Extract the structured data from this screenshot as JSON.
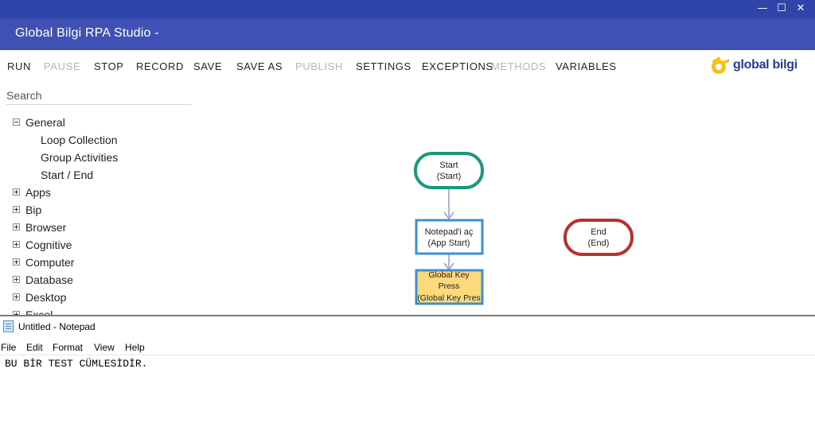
{
  "window": {
    "title": "Global Bilgi RPA Studio -",
    "controls": {
      "minimize": "—",
      "maximize": "☐",
      "close": "✕"
    }
  },
  "toolbar": {
    "items": [
      {
        "label": "RUN",
        "enabled": true
      },
      {
        "label": "PAUSE",
        "enabled": false
      },
      {
        "label": "STOP",
        "enabled": true
      },
      {
        "label": "RECORD",
        "enabled": true
      },
      {
        "label": "SAVE",
        "enabled": true
      },
      {
        "label": "SAVE AS",
        "enabled": true
      },
      {
        "label": "PUBLISH",
        "enabled": false
      },
      {
        "label": "SETTINGS",
        "enabled": true
      },
      {
        "label": "EXCEPTIONS",
        "enabled": true
      },
      {
        "label": "METHODS",
        "enabled": false
      },
      {
        "label": "VARIABLES",
        "enabled": true
      }
    ],
    "logo_text": "global bilgi"
  },
  "search": {
    "placeholder": "Search",
    "value": ""
  },
  "tree": {
    "items": [
      {
        "label": "General",
        "expanded": true
      },
      {
        "label": "Loop Collection",
        "child": true
      },
      {
        "label": "Group Activities",
        "child": true
      },
      {
        "label": "Start / End",
        "child": true
      },
      {
        "label": "Apps",
        "expanded": false
      },
      {
        "label": "Bip",
        "expanded": false
      },
      {
        "label": "Browser",
        "expanded": false
      },
      {
        "label": "Cognitive",
        "expanded": false
      },
      {
        "label": "Computer",
        "expanded": false
      },
      {
        "label": "Database",
        "expanded": false
      },
      {
        "label": "Desktop",
        "expanded": false
      },
      {
        "label": "Excel",
        "expanded": false
      }
    ]
  },
  "flow": {
    "nodes": {
      "start": {
        "line1": "Start",
        "line2": "(Start)",
        "color": "#1a9a7a"
      },
      "notepad": {
        "line1": "Notepad'i aç",
        "line2": "(App Start)",
        "color": "#3d8fd0"
      },
      "keypress": {
        "line1": "Global Key",
        "line2": "Press",
        "line3": "(Global Key Pres",
        "color": "#3d8fd0",
        "fill": "#fcd97a"
      },
      "end": {
        "line1": "End",
        "line2": "(End)",
        "color": "#b53328"
      }
    },
    "connector_color": "#9b95d6"
  },
  "notepad": {
    "title": "Untitled - Notepad",
    "menu": [
      "File",
      "Edit",
      "Format",
      "View",
      "Help"
    ],
    "content": "BU BİR TEST CÜMLESİDİR."
  }
}
